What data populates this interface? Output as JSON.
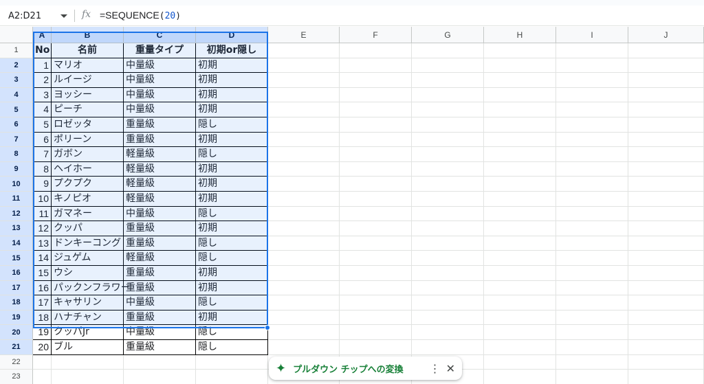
{
  "formula_bar": {
    "name_box": "A2:D21",
    "fx_label": "fx",
    "formula_prefix": "=SEQUENCE",
    "formula_open": "(",
    "formula_arg": "20",
    "formula_close": ")"
  },
  "columns": [
    "A",
    "B",
    "C",
    "D",
    "E",
    "F",
    "G",
    "H",
    "I",
    "J"
  ],
  "rows": [
    "1",
    "2",
    "3",
    "4",
    "5",
    "6",
    "7",
    "8",
    "9",
    "10",
    "11",
    "12",
    "13",
    "14",
    "15",
    "16",
    "17",
    "18",
    "19",
    "20",
    "21",
    "22",
    "23"
  ],
  "header": [
    "No",
    "名前",
    "重量タイプ",
    "初期or隠し"
  ],
  "table": [
    [
      "1",
      "マリオ",
      "中量級",
      "初期"
    ],
    [
      "2",
      "ルイージ",
      "中量級",
      "初期"
    ],
    [
      "3",
      "ヨッシー",
      "中量級",
      "初期"
    ],
    [
      "4",
      "ピーチ",
      "中量級",
      "初期"
    ],
    [
      "5",
      "ロゼッタ",
      "重量級",
      "隠し"
    ],
    [
      "6",
      "ポリーン",
      "重量級",
      "初期"
    ],
    [
      "7",
      "ガボン",
      "軽量級",
      "隠し"
    ],
    [
      "8",
      "ヘイホー",
      "軽量級",
      "初期"
    ],
    [
      "9",
      "プクプク",
      "軽量級",
      "初期"
    ],
    [
      "10",
      "キノピオ",
      "軽量級",
      "初期"
    ],
    [
      "11",
      "ガマネー",
      "中量級",
      "隠し"
    ],
    [
      "12",
      "クッパ",
      "重量級",
      "初期"
    ],
    [
      "13",
      "ドンキーコング",
      "重量級",
      "隠し"
    ],
    [
      "14",
      "ジュゲム",
      "軽量級",
      "隠し"
    ],
    [
      "15",
      "ウシ",
      "重量級",
      "初期"
    ],
    [
      "16",
      "パックンフラワー",
      "重量級",
      "初期"
    ],
    [
      "17",
      "キャサリン",
      "中量級",
      "隠し"
    ],
    [
      "18",
      "ハナチャン",
      "重量級",
      "初期"
    ],
    [
      "19",
      "クッパJr",
      "中量級",
      "隠し"
    ],
    [
      "20",
      "ブル",
      "重量級",
      "隠し"
    ]
  ],
  "chip": {
    "label": "プルダウン チップへの変換",
    "icons": {
      "sparkle": "sparkle-icon",
      "more": "more-vert-icon",
      "close": "close-icon"
    }
  },
  "colors": {
    "selection": "#1a73e8",
    "chip_text": "#188038"
  }
}
